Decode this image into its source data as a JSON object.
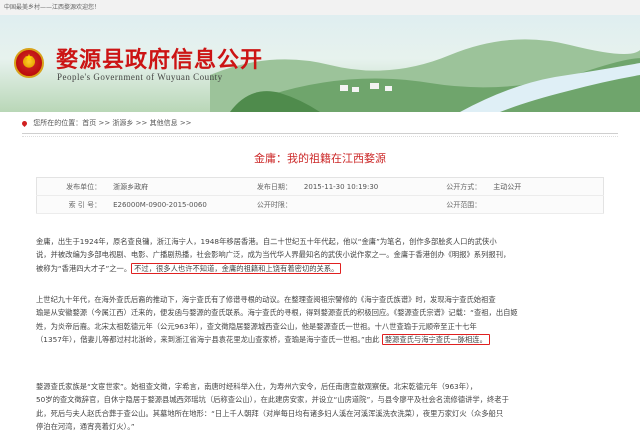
{
  "top_bar": {
    "text": "中国最美乡村——江西婺源欢迎您！"
  },
  "header": {
    "title": "婺源县政府信息公开",
    "subtitle": "People's Government of Wuyuan County"
  },
  "breadcrumb": {
    "prefix": "您所在的位置：首页 >> 浙源乡 >> 其他信息 >>"
  },
  "article": {
    "title": "金庸：我的祖籍在江西婺源"
  },
  "meta": {
    "row1": {
      "k1": "发布单位：",
      "v1": "浙源乡政府",
      "k2": "发布日期：",
      "v2": "2015-11-30 10:19:30",
      "k3": "公开方式：",
      "v3": "主动公开"
    },
    "row2": {
      "k1": "索 引 号：",
      "v1": "E26000M-0900-2015-0060",
      "k2": "公开时限：",
      "v2": "",
      "k3": "公开范围：",
      "v3": ""
    }
  },
  "body": {
    "p1_line1": "金庸，出生于1924年，原名查良镛，浙江海宁人，1948年移居香港。自二十世纪五十年代起，他以“金庸”为笔名，创作多部脍炙人口的武侠小",
    "p1_line2": "说，并被改编为多部电视剧、电影、广播剧热播，社会影响广泛，成为当代华人界最知名的武侠小说作家之一。金庸于香港创办《明报》系列报刊，",
    "p1_line3_a": "被称为“香港四大才子”之一。",
    "p1_line3_hl": "不过，很多人也许不知道，金庸的祖籍和上饶有着密切的关系。",
    "p2_line1": "上世纪九十年代，在海外查氏后裔的推动下，海宁查氏有了修谱寻根的动议。在整理查阅祖宗譬修的《海宁查氏族谱》时，发现海宁查氏始祖查",
    "p2_line2": "瑜是从安徽婺源（今属江西）迁来的，便发函与婺源的查氏联系。海宁查氏的寻根，得到婺源查氏的积极回应。《婺源查氏宗谱》记载：“查祖，出自姬",
    "p2_line3": "姓，为炎帝后裔。北宋太祖乾德元年（公元963年），查文徵隐居婺源城西查公山，他是婺源查氏一世祖。十八世查瑜于元顺帝至正十七年",
    "p2_line4": "（1357年），偕妻儿等都过村北浙岭，来到浙江省海宁县袁花里龙山查家桥，查瑜是海宁查氏一世祖。”由此",
    "p2_line4_hl": "婺源查氏与海宁查氏一脉相连。",
    "p3_line1": "婺源查氏家族是“文宦世家”。始祖查文徵，字希言，南唐时经科举入仕，为寿州六安令，后任南唐宣歙观察使。北宋乾德元年（963年），",
    "p3_line2": "50岁的查文徵辞官，自休宁隐居于婺源县城西郊瑶坑（后称查公山），在此建房安家，并设立“山房道院”，与县令廖平及社会名流修德讲学，终老于",
    "p3_line3": "此，死后与夫人赵氏合葬于查公山。其墓地所在地形：“日上千人朝拜（对岸每日均有诸多妇人溪在河溪浑溪洗衣洗菜），夜里万家灯火（众多船只",
    "p3_line4": "停泊在河湾，通宵亮着灯火）。”"
  }
}
